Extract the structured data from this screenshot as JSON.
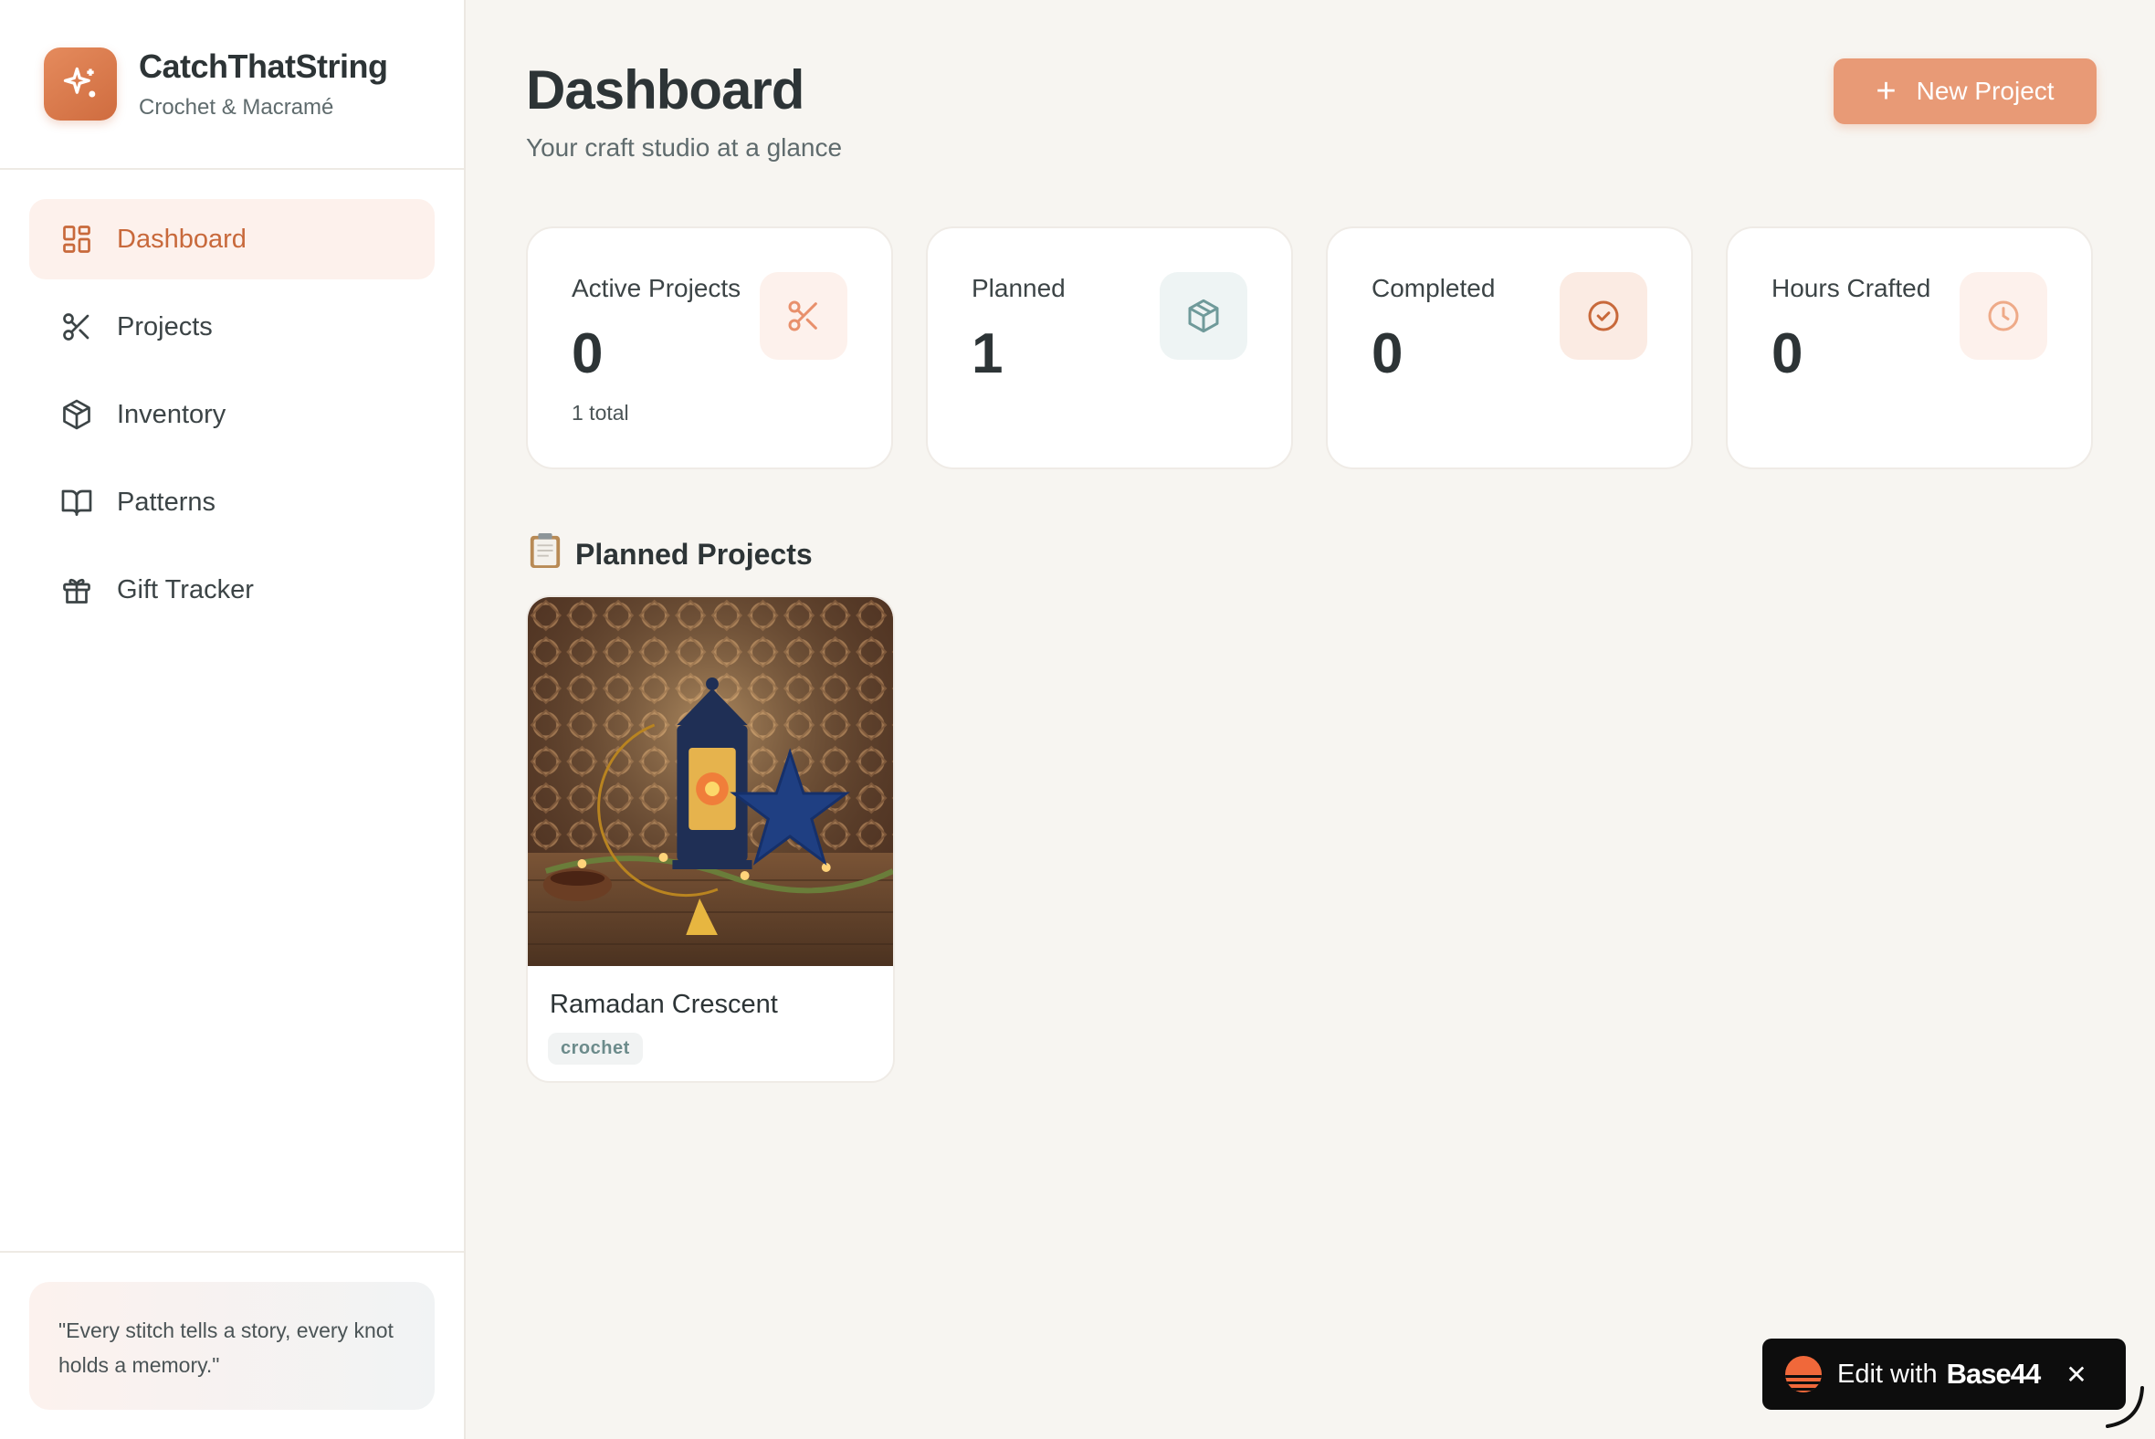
{
  "brand": {
    "title": "CatchThatString",
    "subtitle": "Crochet & Macramé",
    "logo_icon": "sparkles-icon"
  },
  "sidebar": {
    "items": [
      {
        "label": "Dashboard",
        "icon": "grid-icon",
        "active": true
      },
      {
        "label": "Projects",
        "icon": "scissors-icon",
        "active": false
      },
      {
        "label": "Inventory",
        "icon": "package-icon",
        "active": false
      },
      {
        "label": "Patterns",
        "icon": "book-open-icon",
        "active": false
      },
      {
        "label": "Gift Tracker",
        "icon": "gift-icon",
        "active": false
      }
    ],
    "quote": "\"Every stitch tells a story, every knot holds a memory.\""
  },
  "header": {
    "title": "Dashboard",
    "subtitle": "Your craft studio at a glance",
    "new_project_label": "New Project"
  },
  "stats": [
    {
      "label": "Active Projects",
      "value": "0",
      "note": "1 total",
      "icon": "scissors-icon",
      "color": "#e8906c"
    },
    {
      "label": "Planned",
      "value": "1",
      "note": "",
      "icon": "package-icon",
      "color": "#6f9a9a"
    },
    {
      "label": "Completed",
      "value": "0",
      "note": "",
      "icon": "check-circle-icon",
      "color": "#c8693b"
    },
    {
      "label": "Hours Crafted",
      "value": "0",
      "note": "",
      "icon": "clock-icon",
      "color": "#eeaa88"
    }
  ],
  "planned_section": {
    "title": "Planned Projects",
    "projects": [
      {
        "name": "Ramadan Crescent",
        "tag": "crochet"
      }
    ]
  },
  "badge": {
    "text": "Edit with",
    "brand": "Base44"
  },
  "colors": {
    "accent": "#c8693b",
    "button": "#e89a76",
    "background": "#f7f5f1"
  }
}
